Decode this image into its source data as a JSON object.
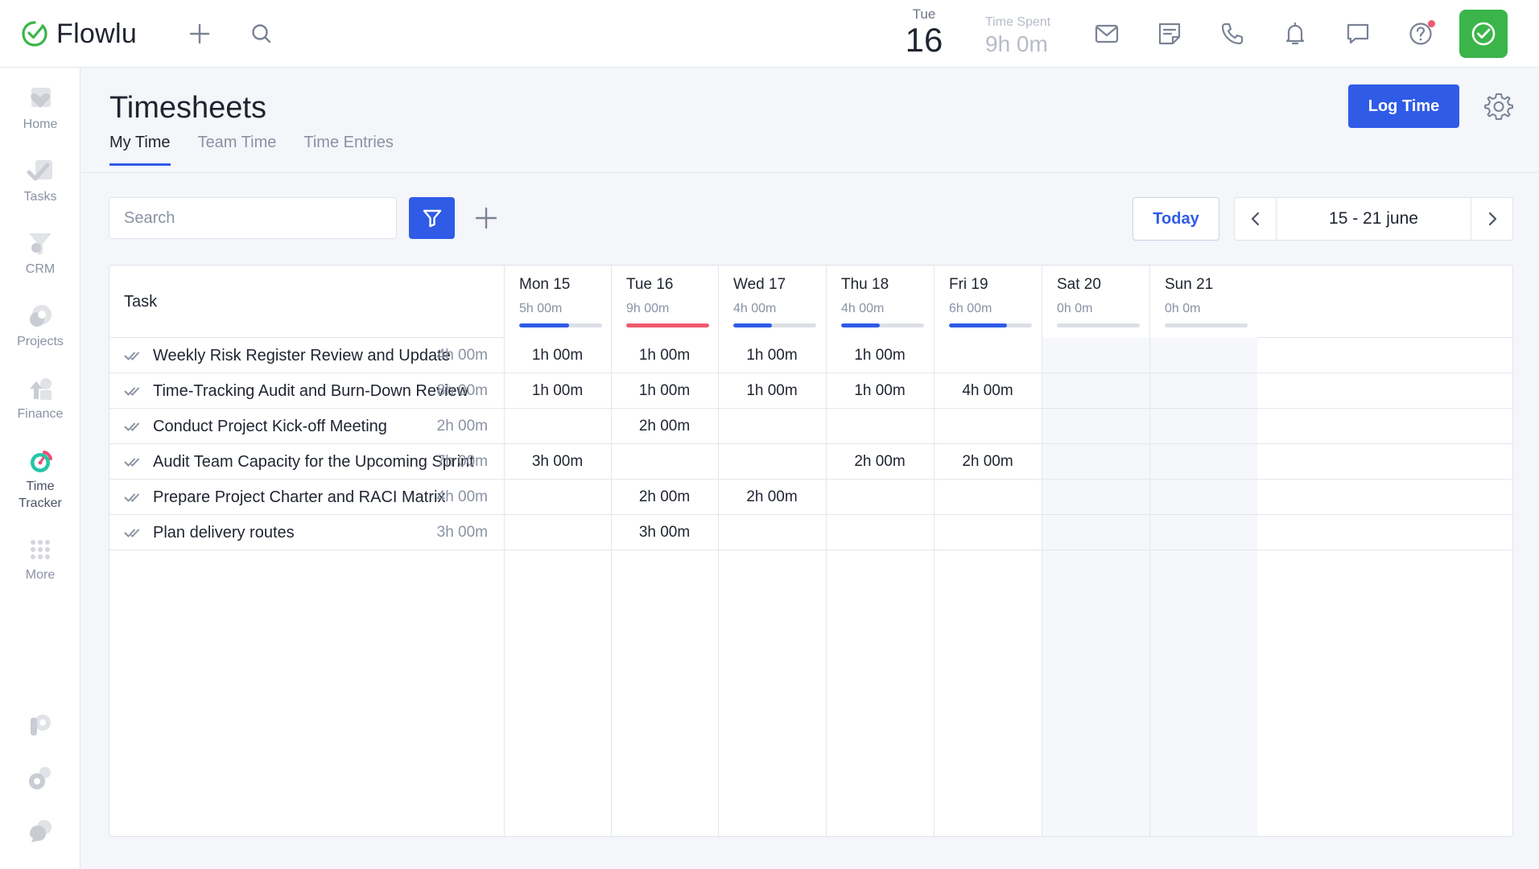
{
  "app": {
    "name": "Flowlu"
  },
  "topbar": {
    "date_dow": "Tue",
    "date_day": "16",
    "time_spent_label": "Time Spent",
    "time_spent_value": "9h 0m",
    "icons": [
      "plus-icon",
      "search-icon",
      "mail-icon",
      "notes-icon",
      "phone-icon",
      "bell-icon",
      "chat-icon",
      "help-icon"
    ],
    "accent": "#3bb54a"
  },
  "sidebar": {
    "items": [
      {
        "label": "Home",
        "icon": "heart-icon"
      },
      {
        "label": "Tasks",
        "icon": "check-icon"
      },
      {
        "label": "CRM",
        "icon": "funnel-icon"
      },
      {
        "label": "Projects",
        "icon": "projects-icon"
      },
      {
        "label": "Finance",
        "icon": "finance-icon"
      },
      {
        "label": "Time Tracker",
        "icon": "timer-icon",
        "active": true
      },
      {
        "label": "More",
        "icon": "grid-dots-icon"
      }
    ]
  },
  "page": {
    "title": "Timesheets",
    "tabs": [
      {
        "label": "My Time",
        "active": true
      },
      {
        "label": "Team Time"
      },
      {
        "label": "Time Entries"
      }
    ],
    "log_time_label": "Log Time",
    "primary_color": "#2f5be7"
  },
  "toolbar": {
    "search_placeholder": "Search",
    "today_label": "Today",
    "range_label": "15 - 21 june"
  },
  "grid": {
    "task_header": "Task",
    "days": [
      {
        "name": "Mon 15",
        "hours": "5h 00m",
        "progress": 0.6,
        "color": "#2f5be7",
        "weekend": false
      },
      {
        "name": "Tue 16",
        "hours": "9h 00m",
        "progress": 1.0,
        "color": "#ef5a6f",
        "weekend": false
      },
      {
        "name": "Wed 17",
        "hours": "4h 00m",
        "progress": 0.47,
        "color": "#2f5be7",
        "weekend": false
      },
      {
        "name": "Thu 18",
        "hours": "4h 00m",
        "progress": 0.47,
        "color": "#2f5be7",
        "weekend": false
      },
      {
        "name": "Fri 19",
        "hours": "6h 00m",
        "progress": 0.7,
        "color": "#2f5be7",
        "weekend": false
      },
      {
        "name": "Sat 20",
        "hours": "0h 0m",
        "progress": 0,
        "color": "#2f5be7",
        "weekend": true
      },
      {
        "name": "Sun 21",
        "hours": "0h 0m",
        "progress": 0,
        "color": "#2f5be7",
        "weekend": true
      }
    ],
    "rows": [
      {
        "title": "Weekly Risk Register Review and Update",
        "total": "4h 00m",
        "cells": [
          "1h 00m",
          "1h 00m",
          "1h 00m",
          "1h 00m",
          "",
          "",
          ""
        ]
      },
      {
        "title": "Time-Tracking Audit and Burn-Down Review",
        "total": "8h 00m",
        "cells": [
          "1h 00m",
          "1h 00m",
          "1h 00m",
          "1h 00m",
          "4h 00m",
          "",
          ""
        ]
      },
      {
        "title": "Conduct Project Kick-off Meeting",
        "total": "2h 00m",
        "cells": [
          "",
          "2h 00m",
          "",
          "",
          "",
          "",
          ""
        ]
      },
      {
        "title": "Audit Team Capacity for the Upcoming Sprint",
        "total": "7h 00m",
        "cells": [
          "3h 00m",
          "",
          "",
          "2h 00m",
          "2h 00m",
          "",
          ""
        ]
      },
      {
        "title": "Prepare Project Charter and RACI Matrix",
        "total": "4h 00m",
        "cells": [
          "",
          "2h 00m",
          "2h 00m",
          "",
          "",
          "",
          ""
        ]
      },
      {
        "title": "Plan delivery routes",
        "total": "3h 00m",
        "cells": [
          "",
          "3h 00m",
          "",
          "",
          "",
          "",
          ""
        ]
      }
    ]
  }
}
